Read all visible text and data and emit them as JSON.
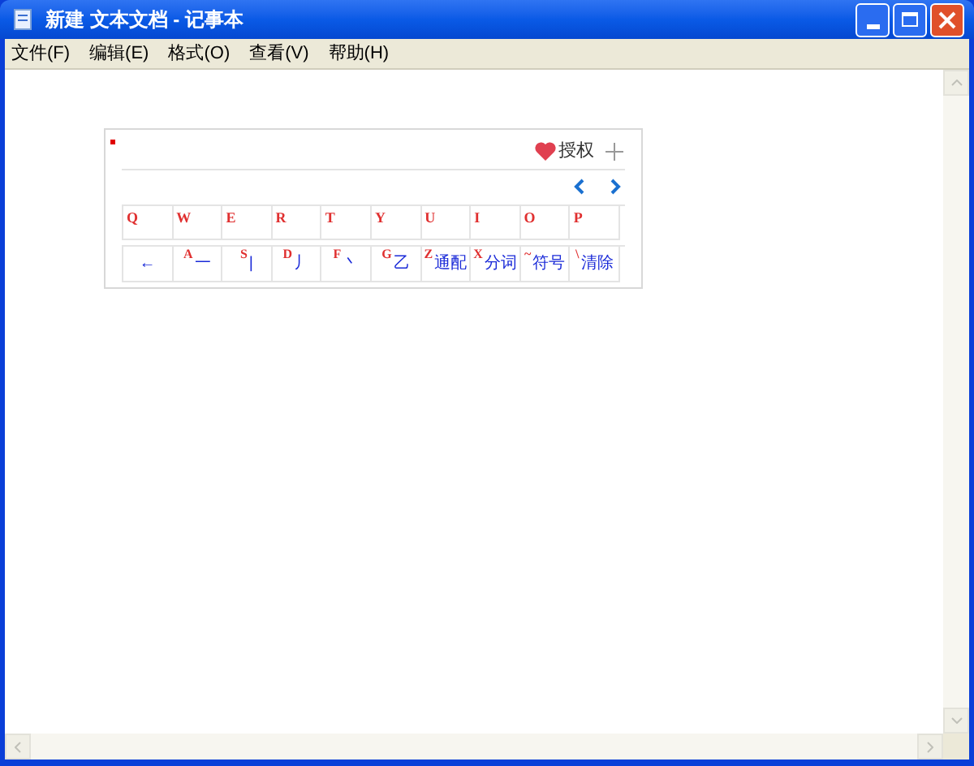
{
  "window": {
    "title": "新建 文本文档 - 记事本"
  },
  "menu": [
    "文件(F)",
    "编辑(E)",
    "格式(O)",
    "查看(V)",
    "帮助(H)"
  ],
  "ime_panel": {
    "auth_label": "授权",
    "letter_keys": [
      "Q",
      "W",
      "E",
      "R",
      "T",
      "Y",
      "U",
      "I",
      "O",
      "P"
    ],
    "stroke_keys": [
      {
        "symbol": "←"
      },
      {
        "letter": "A",
        "symbol": "一"
      },
      {
        "letter": "S",
        "symbol": "|"
      },
      {
        "letter": "D",
        "symbol": "丿"
      },
      {
        "letter": "F",
        "symbol": "丶"
      },
      {
        "letter": "G",
        "symbol": "乙"
      },
      {
        "letter": "Z",
        "symbol": "通配"
      },
      {
        "letter": "X",
        "symbol": "分词"
      },
      {
        "letter": "~",
        "symbol": "符号"
      },
      {
        "letter": "\\",
        "symbol": "清除"
      }
    ]
  }
}
